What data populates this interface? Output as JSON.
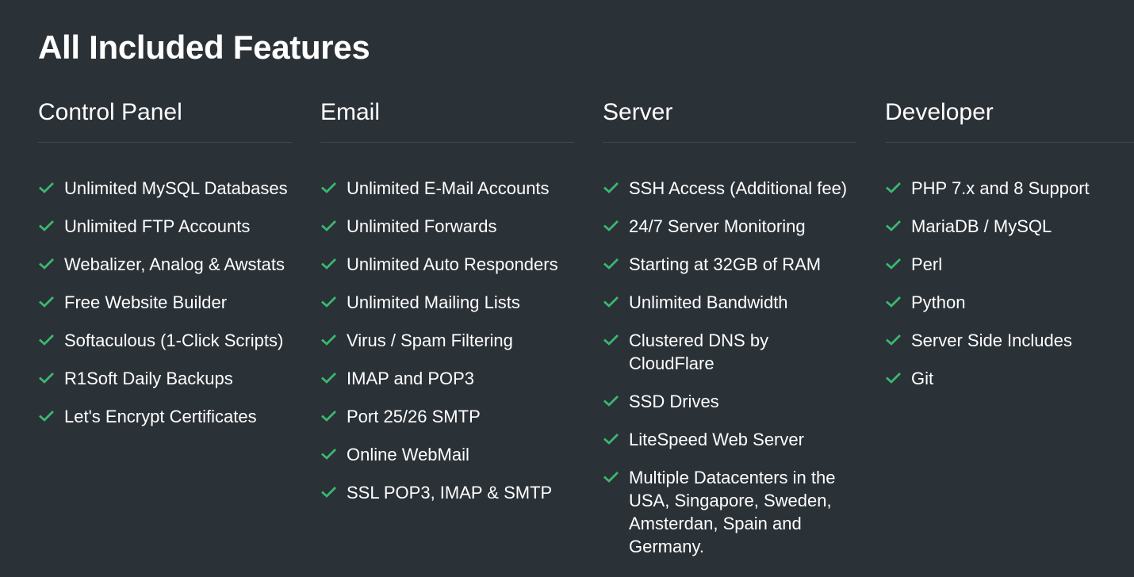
{
  "page": {
    "title": "All Included Features",
    "check_color": "#3bb870"
  },
  "columns": [
    {
      "heading": "Control Panel",
      "items": [
        "Unlimited MySQL Databases",
        "Unlimited FTP Accounts",
        "Webalizer, Analog & Awstats",
        "Free Website Builder",
        "Softaculous (1-Click Scripts)",
        "R1Soft Daily Backups",
        "Let's Encrypt Certificates"
      ]
    },
    {
      "heading": "Email",
      "items": [
        "Unlimited E-Mail Accounts",
        "Unlimited Forwards",
        "Unlimited Auto Responders",
        "Unlimited Mailing Lists",
        "Virus / Spam Filtering",
        "IMAP and POP3",
        "Port 25/26 SMTP",
        "Online WebMail",
        "SSL POP3, IMAP & SMTP"
      ]
    },
    {
      "heading": "Server",
      "items": [
        "SSH Access (Additional fee)",
        "24/7 Server Monitoring",
        "Starting at 32GB of RAM",
        "Unlimited Bandwidth",
        "Clustered DNS by CloudFlare",
        "SSD Drives",
        "LiteSpeed Web Server",
        "Multiple Datacenters in the USA, Singapore, Sweden, Amsterdan, Spain and Germany."
      ]
    },
    {
      "heading": "Developer",
      "items": [
        "PHP 7.x and 8 Support",
        "MariaDB / MySQL",
        "Perl",
        "Python",
        "Server Side Includes",
        "Git"
      ]
    }
  ]
}
